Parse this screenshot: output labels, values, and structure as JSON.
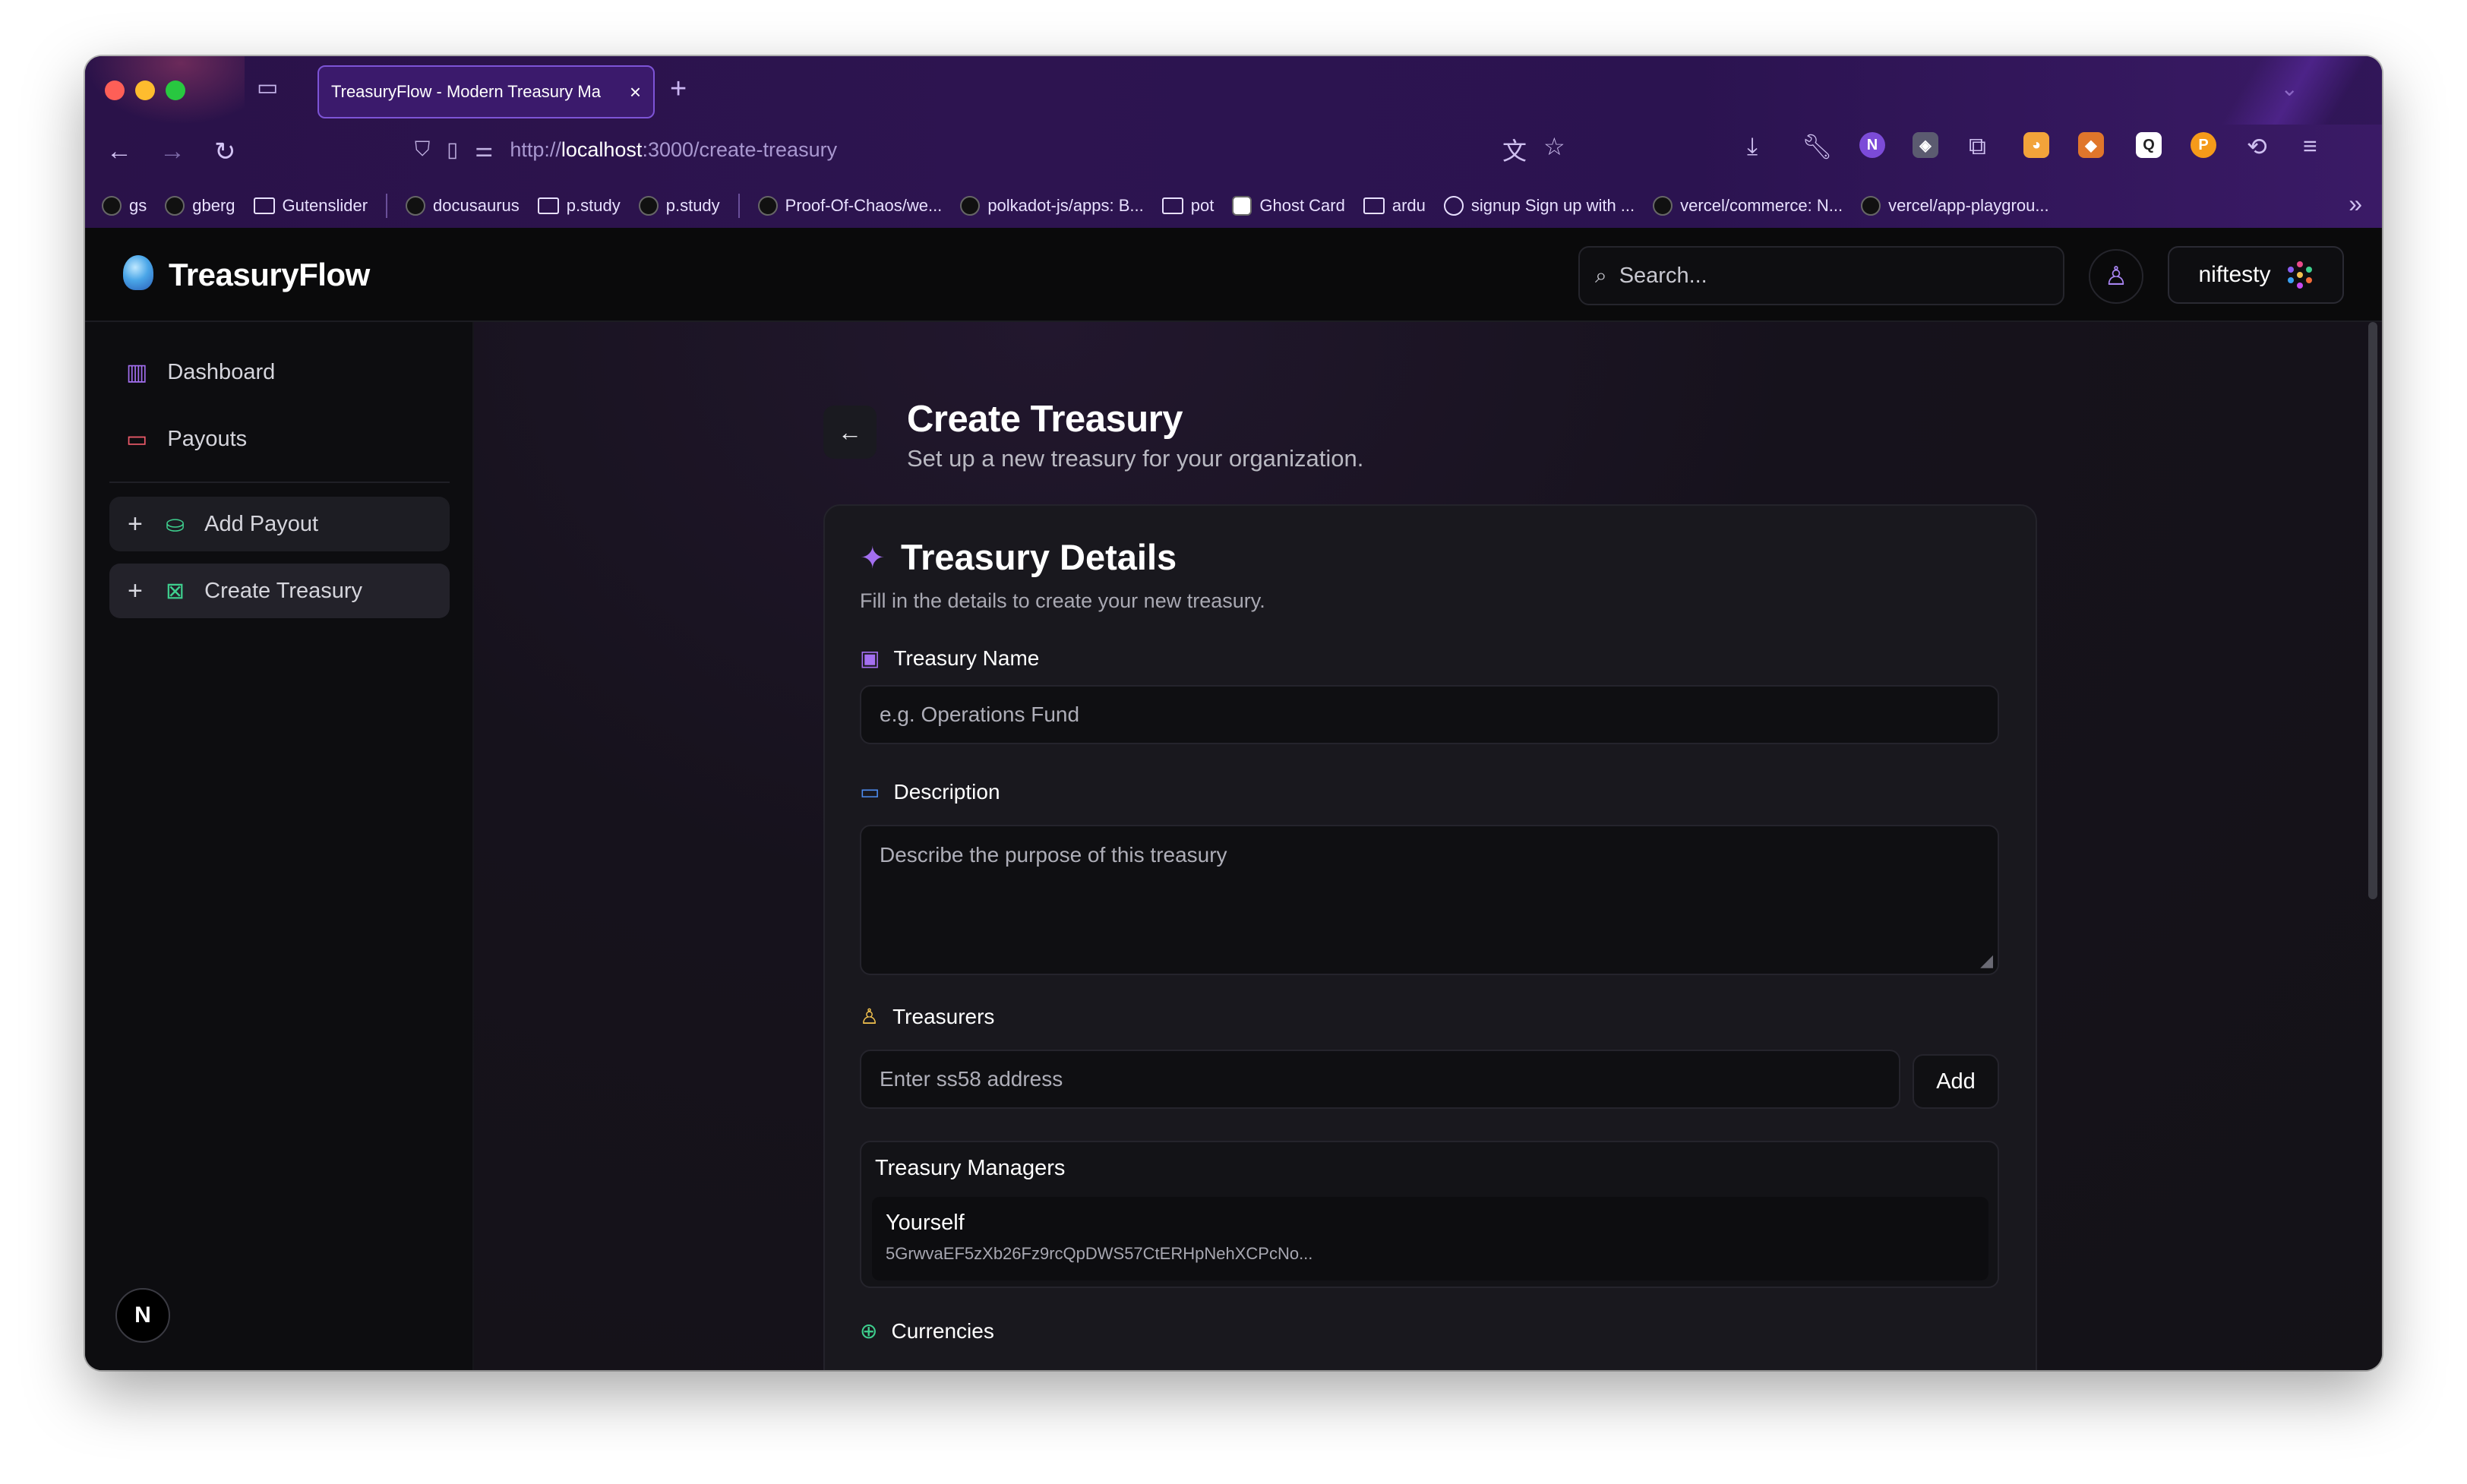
{
  "browser": {
    "tab_title": "TreasuryFlow - Modern Treasury Ma",
    "url_scheme": "http://",
    "url_host": "localhost",
    "url_path": ":3000/create-treasury",
    "bookmarks": [
      {
        "label": "gs",
        "icon": "wordpress-icon"
      },
      {
        "label": "gberg",
        "icon": "github-icon"
      },
      {
        "label": "Gutenslider",
        "icon": "folder-icon"
      },
      {
        "label": "docusaurus",
        "icon": "github-icon"
      },
      {
        "label": "p.study",
        "icon": "folder-icon"
      },
      {
        "label": "p.study",
        "icon": "github-icon"
      },
      {
        "label": "Proof-Of-Chaos/we...",
        "icon": "github-icon"
      },
      {
        "label": "polkadot-js/apps: B...",
        "icon": "github-icon"
      },
      {
        "label": "pot",
        "icon": "folder-icon"
      },
      {
        "label": "Ghost Card",
        "icon": "ghost-icon"
      },
      {
        "label": "ardu",
        "icon": "folder-icon"
      },
      {
        "label": "signup Sign up with ...",
        "icon": "globe-icon"
      },
      {
        "label": "vercel/commerce: N...",
        "icon": "github-icon"
      },
      {
        "label": "vercel/app-playgrou...",
        "icon": "github-icon"
      }
    ]
  },
  "app": {
    "brand": "TreasuryFlow",
    "search_placeholder": "Search...",
    "account_name": "niftesty"
  },
  "sidebar": {
    "items": [
      {
        "label": "Dashboard",
        "icon": "bar-chart-icon"
      },
      {
        "label": "Payouts",
        "icon": "credit-card-icon"
      }
    ],
    "actions": [
      {
        "label": "Add Payout",
        "icon": "coins-icon"
      },
      {
        "label": "Create Treasury",
        "icon": "vault-icon"
      }
    ],
    "footer_badge": "N"
  },
  "page": {
    "title": "Create Treasury",
    "subtitle": "Set up a new treasury for your organization."
  },
  "form": {
    "card_title": "Treasury Details",
    "card_subtitle": "Fill in the details to create your new treasury.",
    "name_label": "Treasury Name",
    "name_placeholder": "e.g. Operations Fund",
    "description_label": "Description",
    "description_placeholder": "Describe the purpose of this treasury",
    "treasurers_label": "Treasurers",
    "treasurers_placeholder": "Enter ss58 address",
    "add_label": "Add",
    "managers_title": "Treasury Managers",
    "manager_name": "Yourself",
    "manager_address": "5GrwvaEF5zXb26Fz9rcQpDWS57CtERHpNehXCPcNo...",
    "currencies_label": "Currencies"
  },
  "colors": {
    "accent_purple": "#a36ff0",
    "payouts_red": "#ef5b6b",
    "treasurers_yellow": "#f2c14e",
    "currencies_green": "#3ecf8e",
    "add_payout_green": "#3ecf8e"
  }
}
